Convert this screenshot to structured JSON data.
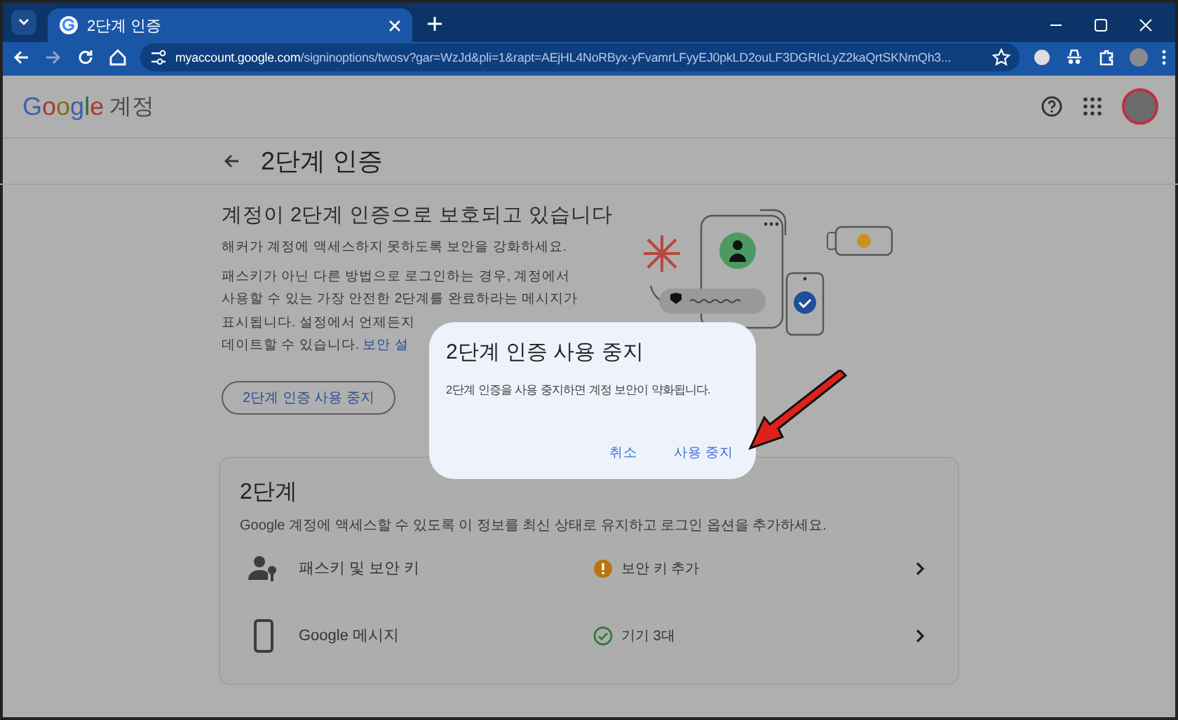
{
  "browser": {
    "tab": {
      "title": "2단계 인증",
      "selected": true
    },
    "address": {
      "domain": "myaccount.google.com",
      "path": "/signinoptions/twosv?gar=WzJd&pli=1&rapt=AEjHL4NoRByx-yFvamrLFyyEJ0pkLD2ouLF3DGRIcLyZ2kaQrtSKNmQh3..."
    }
  },
  "header": {
    "logo": "Google",
    "product": "계정"
  },
  "page": {
    "title": "2단계 인증"
  },
  "intro": {
    "heading": "계정이 2단계 인증으로 보호되고 있습니다",
    "lead": "해커가 계정에 액세스하지 못하도록 보안을 강화하세요.",
    "lines": [
      "패스키가 아닌 다른 방법으로 로그인하는 경우, 계정에서",
      "사용할 수 있는 가장 안전한 2단계를 완료하라는 메시지가",
      "표시됩니다. 설정에서 언제든지",
      "데이트할 수 있습니다."
    ],
    "link": "보안 설",
    "button": "2단계 인증 사용 중지"
  },
  "card": {
    "title": "2단계",
    "description": "Google 계정에 액세스할 수 있도록 이 정보를 최신 상태로 유지하고 로그인 옵션을 추가하세요.",
    "rows": [
      {
        "kind": "passkeys",
        "label": "패스키 및 보안 키",
        "status": {
          "kind": "warning",
          "text": "보안 키 추가"
        }
      },
      {
        "kind": "phone",
        "label": "Google 메시지",
        "status": {
          "kind": "ok",
          "text": "기기 3대"
        }
      }
    ]
  },
  "dialog": {
    "title": "2단계 인증 사용 중지",
    "message": "2단계 인증을 사용 중지하면 계정 보안이 약화됩니다.",
    "buttons": [
      "취소",
      "사용 중지"
    ]
  }
}
